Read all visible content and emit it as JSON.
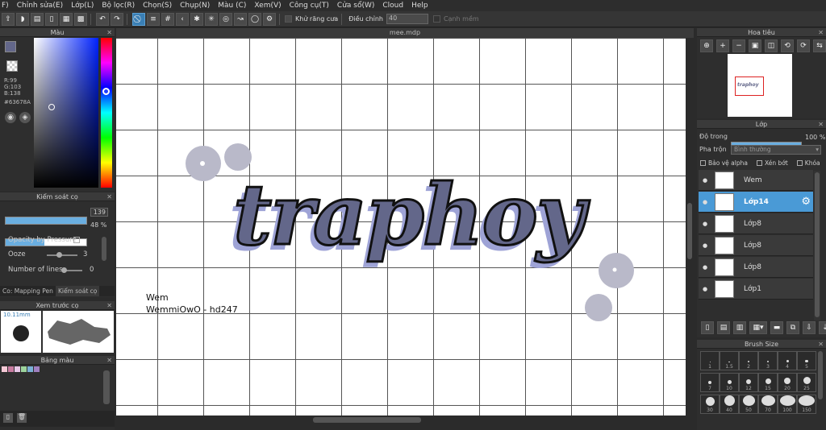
{
  "menu": [
    "F)",
    "Chỉnh sửa(E)",
    "Lớp(L)",
    "Bộ lọc(R)",
    "Chọn(S)",
    "Chụp(N)",
    "Màu (C)",
    "Xem(V)",
    "Công cụ(T)",
    "Cửa sổ(W)",
    "Cloud",
    "Help"
  ],
  "toolbar": {
    "antialias": "Khử răng cưa",
    "adjust": "Điều chỉnh",
    "adjust_value": "40",
    "smooth": "Cạnh mềm"
  },
  "color_panel": {
    "title": "Màu",
    "r": "R:99",
    "g": "G:103",
    "b": "B:138",
    "hex": "#63678A",
    "current_color": "#63678A"
  },
  "brush_control": {
    "title": "Kiểm soát cọ",
    "size_value": "139",
    "size_fraction": 1.0,
    "opacity_value": "48 %",
    "opacity_fraction": 0.48,
    "opacity_pressure_label": "Opacity by Pressure",
    "ooze_label": "Ooze",
    "ooze_value": "3",
    "lines_label": "Number of lines",
    "lines_value": "0",
    "tab1": "Co: Mapping Pen",
    "tab2": "Kiểm soát cọ"
  },
  "brush_preview": {
    "title": "Xem trước cọ",
    "size": "10.11mm"
  },
  "palette": {
    "title": "Bảng màu",
    "swatches": [
      "#f5c9d6",
      "#c77ba0",
      "#e8c8e8",
      "#9dd49d",
      "#7ab0d6",
      "#a080c0"
    ]
  },
  "canvas": {
    "tab": "mee.mdp",
    "lettering": "traphoy",
    "signature_line1": "Wem",
    "signature_line2": "WemmiOwO - hd247"
  },
  "navigator": {
    "title": "Hoa tiêu",
    "thumb_text": "traphoy"
  },
  "layers": {
    "title": "Lớp",
    "opacity_label": "Độ trong",
    "opacity_value": "100 %",
    "opacity_fraction": 1.0,
    "blend_label": "Pha trộn",
    "blend_value": "Bình thường",
    "protect_alpha": "Bảo vệ alpha",
    "clipping": "Xén bớt",
    "lock": "Khóa",
    "items": [
      {
        "name": "Wem",
        "selected": false
      },
      {
        "name": "Lớp14",
        "selected": true
      },
      {
        "name": "Lớp8",
        "selected": false
      },
      {
        "name": "Lớp8",
        "selected": false
      },
      {
        "name": "Lớp8",
        "selected": false
      },
      {
        "name": "Lớp1",
        "selected": false
      }
    ]
  },
  "brush_size": {
    "title": "Brush Size",
    "row1": [
      "1",
      "1.5",
      "2",
      "3",
      "4",
      "5"
    ],
    "row2": [
      "7",
      "10",
      "12",
      "15",
      "20",
      "25"
    ],
    "row3": [
      "30",
      "40",
      "50",
      "70",
      "100",
      "150"
    ]
  }
}
